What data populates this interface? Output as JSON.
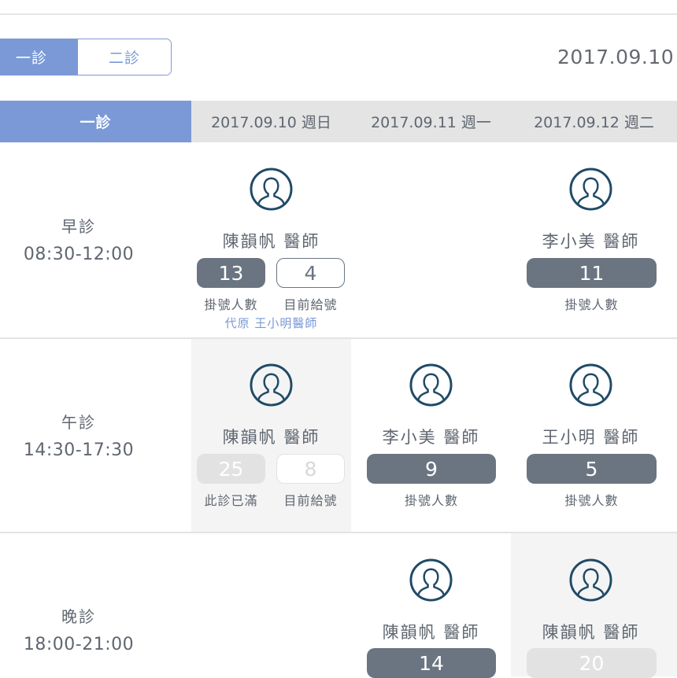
{
  "tabs": {
    "first_clinic": "一診",
    "second_clinic": "二診"
  },
  "date_range": "2017.09.10 -",
  "header": {
    "clinic": "一診",
    "days": [
      "2017.09.10 週日",
      "2017.09.11 週一",
      "2017.09.12 週二"
    ]
  },
  "sessions": [
    {
      "name": "早診",
      "time": "08:30-12:00",
      "cells": [
        {
          "doctor": "陳韻帆 醫師",
          "count": "13",
          "current": "4",
          "count_label": "掛號人數",
          "current_label": "目前給號",
          "substitute": "代原 王小明醫師"
        },
        null,
        {
          "doctor": "李小美 醫師",
          "count": "11",
          "count_label": "掛號人數"
        }
      ]
    },
    {
      "name": "午診",
      "time": "14:30-17:30",
      "cells": [
        {
          "doctor": "陳韻帆 醫師",
          "count": "25",
          "current": "8",
          "count_label": "此診已滿",
          "current_label": "目前給號"
        },
        {
          "doctor": "李小美 醫師",
          "count": "9",
          "count_label": "掛號人數"
        },
        {
          "doctor": "王小明 醫師",
          "count": "5",
          "count_label": "掛號人數"
        }
      ]
    },
    {
      "name": "晚診",
      "time": "18:00-21:00",
      "cells": [
        null,
        {
          "doctor": "陳韻帆 醫師",
          "count": "14"
        },
        {
          "doctor": "陳韻帆 醫師",
          "count": "20"
        }
      ]
    }
  ],
  "colors": {
    "accent": "#7a99d6",
    "pill_dark": "#6b7581",
    "faded": "#e2e2e2",
    "icon": "#1f4a66"
  }
}
